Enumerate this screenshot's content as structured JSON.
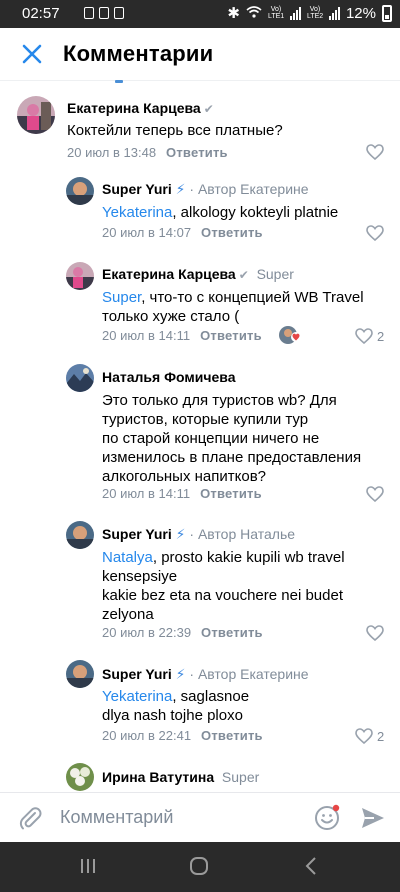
{
  "status": {
    "time": "02:57",
    "lte1": "Vo) LTE1",
    "lte2": "Vo) LTE2",
    "battery": "12%"
  },
  "header": {
    "title": "Комментарии",
    "close_icon": "close-icon"
  },
  "comments": [
    {
      "author": "Екатерина Карцева",
      "text": "Коктейли теперь все платные?",
      "time": "20 июл в 13:48",
      "reply": "Ответить"
    },
    {
      "author": "Super Yuri",
      "bolt": "⚡",
      "meta": " · Автор  Екатерине",
      "mention": "Yekaterina",
      "text": ", alkology kokteyli platnie",
      "time": "20 июл в 14:07",
      "reply": "Ответить"
    },
    {
      "author": "Екатерина Карцева",
      "meta": "Super",
      "mention": "Super",
      "text_line1": ", что-то с концепцией WB Travel",
      "text_line2": "только хуже стало (",
      "time": "20 июл в 14:11",
      "reply": "Ответить",
      "likes": "2"
    },
    {
      "author": "Наталья Фомичева",
      "lines": [
        "Это только для туристов wb? Для",
        "туристов, которые купили тур",
        "по старой концепции ничего не",
        "изменилось в плане предоставления",
        "алкогольных напитков?"
      ],
      "time": "20 июл в 14:11",
      "reply": "Ответить"
    },
    {
      "author": "Super Yuri",
      "bolt": "⚡",
      "meta": " · Автор  Наталье",
      "mention": "Natalya",
      "text_line1": ", prosto kakie kupili wb travel",
      "lines": [
        "kensepsiye",
        "kakie bez eta na vouchere nei budet",
        "zelyona"
      ],
      "time": "20 июл в 22:39",
      "reply": "Ответить"
    },
    {
      "author": "Super Yuri",
      "bolt": "⚡",
      "meta": " · Автор  Екатерине",
      "mention": "Yekaterina",
      "text_line1": ", saglasnoe",
      "text_line2": "dlya nash tojhe ploxo",
      "time": "20 июл в 22:41",
      "reply": "Ответить",
      "likes": "2"
    },
    {
      "author": "Ирина Ватутина",
      "meta": "Super"
    }
  ],
  "input": {
    "placeholder": "Комментарий"
  },
  "colors": {
    "accent": "#2688eb",
    "secondary": "#818c99",
    "verified": "#99a2ad"
  }
}
